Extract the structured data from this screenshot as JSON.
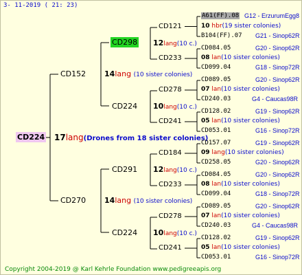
{
  "date": "3- 11-2019 ( 21: 23)",
  "footer": "Copyright 2004-2019 @ Karl Kehrle Foundation   www.pedigreeapis.org",
  "root": {
    "name": "CD224",
    "num": "17",
    "lang": "lang",
    "note": "(Drones from 18 sister colonies)"
  },
  "gen2": [
    {
      "name": "CD152",
      "num": "14",
      "lang": "lang",
      "note": "(10 sister colonies)"
    },
    {
      "name": "CD270",
      "num": "14",
      "lang": "lang",
      "note": "(10 sister colonies)"
    }
  ],
  "gen3": [
    {
      "name": "CD298",
      "num": "12",
      "lang": "lang",
      "note": "(10 c.)"
    },
    {
      "name": "CD224",
      "num": "10",
      "lang": "lang",
      "note": "(10 c.)"
    },
    {
      "name": "CD291",
      "num": "12",
      "lang": "lang",
      "note": "(10 c.)"
    },
    {
      "name": "CD224",
      "num": "10",
      "lang": "lang",
      "note": "(10 c.)"
    }
  ],
  "gen4": [
    {
      "name": "CD121",
      "num": "10",
      "lang": "hbr",
      "note": "(19 sister colonies)"
    },
    {
      "name": "CD233",
      "num": "08",
      "lang": "lan",
      "note": "(10 sister colonies)"
    },
    {
      "name": "CD278",
      "num": "07",
      "lang": "lan",
      "note": "(10 sister colonies)"
    },
    {
      "name": "CD241",
      "num": "05",
      "lang": "lan",
      "note": "(10 sister colonies)"
    },
    {
      "name": "CD184",
      "num": "09",
      "lang": "lang",
      "note": "(10 sister colonies)"
    },
    {
      "name": "CD233",
      "num": "08",
      "lang": "lan",
      "note": "(10 sister colonies)"
    },
    {
      "name": "CD278",
      "num": "07",
      "lang": "lan",
      "note": "(10 sister colonies)"
    },
    {
      "name": "CD241",
      "num": "05",
      "lang": "lan",
      "note": "(10 sister colonies)"
    }
  ],
  "gen5": [
    {
      "name": "A61(FF).08",
      "info": "G12 - ErzurumEgg8"
    },
    {
      "name": "B104(FF).07",
      "info": "G21 - Sinop62R"
    },
    {
      "name": "CD084.05",
      "info": "G20 - Sinop62R"
    },
    {
      "name": "CD099.04",
      "info": "G18 - Sinop72R"
    },
    {
      "name": "CD089.05",
      "info": "G20 - Sinop62R"
    },
    {
      "name": "CD240.03",
      "info": "G4 - Caucas98R"
    },
    {
      "name": "CD128.02",
      "info": "G19 - Sinop62R"
    },
    {
      "name": "CD053.01",
      "info": "G16 - Sinop72R"
    },
    {
      "name": "CD157.07",
      "info": "G19 - Sinop62R"
    },
    {
      "name": "CD258.05",
      "info": "G20 - Sinop62R"
    },
    {
      "name": "CD084.05",
      "info": "G20 - Sinop62R"
    },
    {
      "name": "CD099.04",
      "info": "G18 - Sinop72R"
    },
    {
      "name": "CD089.05",
      "info": "G20 - Sinop62R"
    },
    {
      "name": "CD240.03",
      "info": "G4 - Caucas98R"
    },
    {
      "name": "CD128.02",
      "info": "G19 - Sinop62R"
    },
    {
      "name": "CD053.01",
      "info": "G16 - Sinop72R"
    }
  ]
}
